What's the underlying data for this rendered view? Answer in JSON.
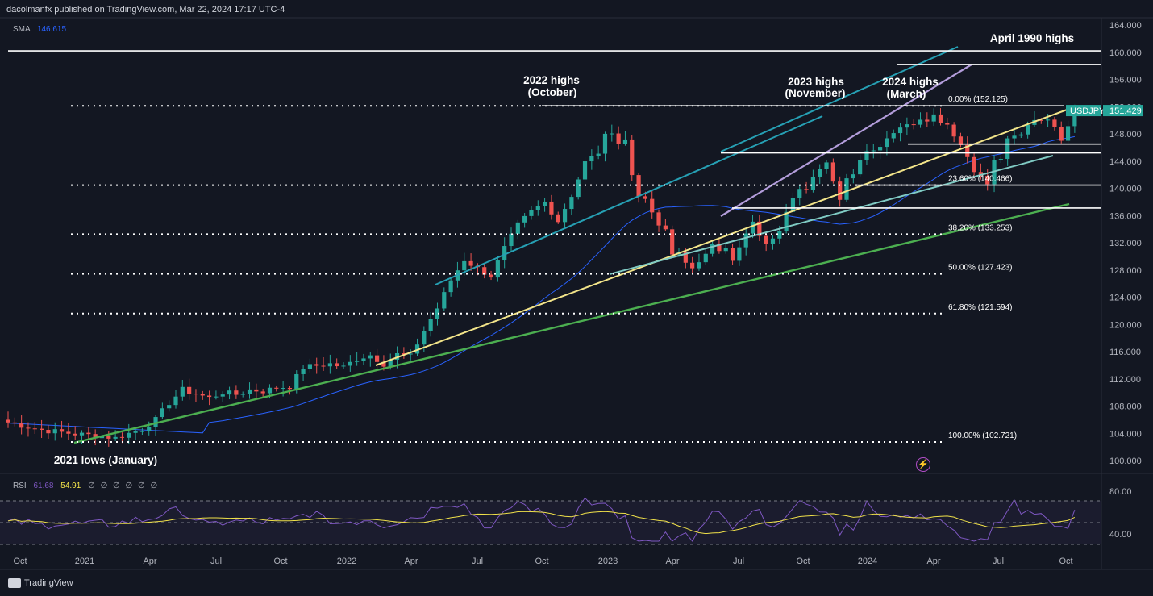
{
  "header": {
    "published": "dacolmanfx published on TradingView.com, Mar 22, 2024 17:17 UTC-4"
  },
  "sma": {
    "label": "SMA",
    "value": "146.615"
  },
  "rsi": {
    "label": "RSI",
    "value1": "61.68",
    "value2": "54.91",
    "extra": "∅ ∅ ∅ ∅ ∅ ∅",
    "levels": [
      "80.00",
      "40.00"
    ]
  },
  "footer": {
    "brand": "TradingView"
  },
  "symbol": {
    "name": "USDJPY",
    "price": "151.429",
    "price_value": 151.429,
    "tag_color": "#26a69a"
  },
  "colors": {
    "up": "#26a69a",
    "down": "#ef5350",
    "sma": "#2962ff",
    "rsi": "#7e57c2",
    "rsi_ma": "#f0e14a"
  },
  "chart_data": {
    "type": "candlestick",
    "symbol": "USDJPY",
    "timeframe": "weekly",
    "y_axis_ticks": [
      "164.000",
      "160.000",
      "156.000",
      "152.000",
      "148.000",
      "144.000",
      "140.000",
      "136.000",
      "132.000",
      "128.000",
      "124.000",
      "120.000",
      "116.000",
      "112.000",
      "108.000",
      "104.000",
      "100.000"
    ],
    "ylim": [
      99,
      164.6
    ],
    "x_axis_ticks": [
      "Oct",
      "2021",
      "Apr",
      "Jul",
      "Oct",
      "2022",
      "Apr",
      "Jul",
      "Oct",
      "2023",
      "Apr",
      "Jul",
      "Oct",
      "2024",
      "Apr",
      "Jul",
      "Oct"
    ],
    "annotations": [
      {
        "text": "April 1990 highs"
      },
      {
        "text": "2022 highs"
      },
      {
        "text": "(October)"
      },
      {
        "text": "2023 highs"
      },
      {
        "text": "(November)"
      },
      {
        "text": "2024 highs"
      },
      {
        "text": "(March)"
      },
      {
        "text": "2021 lows (January)"
      }
    ],
    "fibonacci": [
      {
        "label": "0.00% (152.125)",
        "price": 152.125
      },
      {
        "label": "23.60% (140.466)",
        "price": 140.466
      },
      {
        "label": "38.20% (133.253)",
        "price": 133.253
      },
      {
        "label": "50.00% (127.423)",
        "price": 127.423
      },
      {
        "label": "61.80% (121.594)",
        "price": 121.594
      },
      {
        "label": "100.00% (102.721)",
        "price": 102.721
      }
    ],
    "horizontal_levels": [
      160.2,
      158.2,
      152.125,
      146.5,
      145.2,
      140.466,
      137.1
    ],
    "sma_last": 146.615,
    "rsi_last": 61.68,
    "rsi_ma_last": 54.91,
    "rsi_levels": [
      70,
      50,
      30
    ]
  }
}
